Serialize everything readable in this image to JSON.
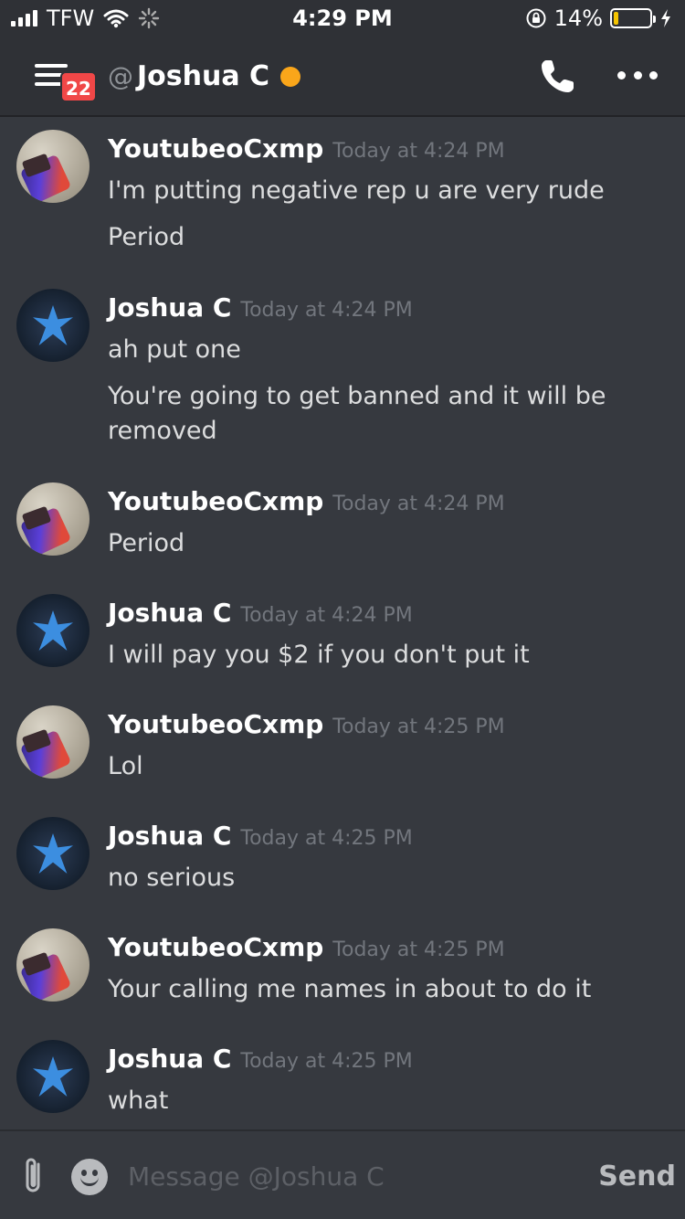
{
  "status_bar": {
    "carrier": "TFW",
    "time": "4:29 PM",
    "battery_percent": "14%",
    "battery_level": 0.14,
    "icons": [
      "signal-icon",
      "wifi-icon",
      "activity-spinner-icon",
      "rotation-lock-icon",
      "battery-icon",
      "charging-icon"
    ]
  },
  "header": {
    "at_symbol": "@",
    "channel_name": "Joshua C",
    "unread_badge": "22",
    "status_color": "#faa61a"
  },
  "messages": [
    {
      "author": "YoutubeoCxmp",
      "timestamp": "Today at 4:24 PM",
      "lines": [
        "I'm putting negative rep u are very rude",
        "Period"
      ]
    },
    {
      "author": "Joshua C",
      "timestamp": "Today at 4:24 PM",
      "lines": [
        "ah put one",
        "You're going to get banned and it will be",
        "removed"
      ]
    },
    {
      "author": "YoutubeoCxmp",
      "timestamp": "Today at 4:24 PM",
      "lines": [
        "Period"
      ]
    },
    {
      "author": "Joshua C",
      "timestamp": "Today at 4:24 PM",
      "lines": [
        "I will pay you $2 if you don't put it"
      ]
    },
    {
      "author": "YoutubeoCxmp",
      "timestamp": "Today at 4:25 PM",
      "lines": [
        "Lol"
      ]
    },
    {
      "author": "Joshua C",
      "timestamp": "Today at 4:25 PM",
      "lines": [
        "no serious"
      ]
    },
    {
      "author": "YoutubeoCxmp",
      "timestamp": "Today at 4:25 PM",
      "lines": [
        "Your calling me names in about to do it"
      ]
    },
    {
      "author": "Joshua C",
      "timestamp": "Today at 4:25 PM",
      "lines": [
        "what"
      ]
    }
  ],
  "composer": {
    "placeholder": "Message @Joshua C",
    "send_label": "Send"
  },
  "colors": {
    "background": "#36393f",
    "header": "#2f3136",
    "badge": "#f04747",
    "idle_status": "#faa61a",
    "battery_fill": "#f5c400"
  }
}
